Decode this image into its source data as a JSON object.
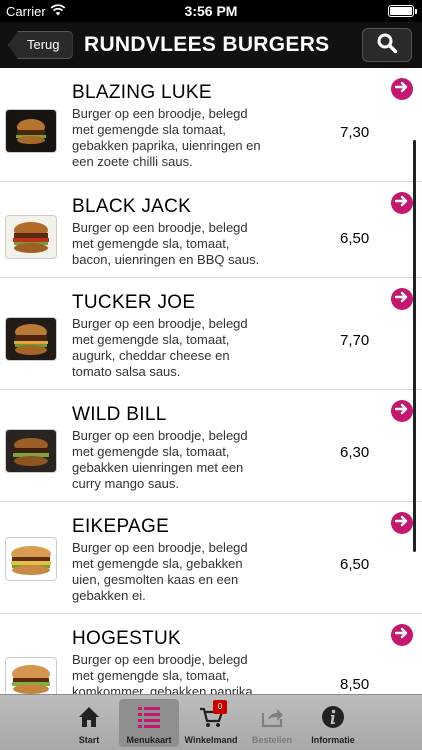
{
  "status_bar": {
    "carrier": "Carrier",
    "time": "3:56 PM",
    "battery_level": 1.0
  },
  "nav": {
    "back_label": "Terug",
    "title": "RUNDVLEES BURGERS",
    "search_icon": "search-icon"
  },
  "menu_items": [
    {
      "name": "BLAZING LUKE",
      "description": "Burger op een broodje, belegd met gemengde sla tomaat, gebakken paprika, uienringen en een zoete chilli saus.",
      "price": "7,30"
    },
    {
      "name": "BLACK JACK",
      "description": "Burger op een broodje, belegd met gemengde sla, tomaat, bacon, uienringen en BBQ saus.",
      "price": "6,50"
    },
    {
      "name": "TUCKER JOE",
      "description": "Burger op een broodje, belegd met gemengde sla, tomaat, augurk, cheddar cheese en tomato salsa saus.",
      "price": "7,70"
    },
    {
      "name": "WILD BILL",
      "description": "Burger op een broodje, belegd met gemengde sla, tomaat, gebakken uienringen met een curry mango saus.",
      "price": "6,30"
    },
    {
      "name": "EIKEPAGE",
      "description": "Burger op een broodje, belegd met gemengde sla, gebakken uien, gesmolten kaas en een gebakken ei.",
      "price": "6,50"
    },
    {
      "name": "HOGESTUK",
      "description": "Burger op een broodje, belegd met gemengde sla, tomaat, komkommer, gebakken paprika,",
      "price": "8,50"
    }
  ],
  "tabs": [
    {
      "label": "Start",
      "icon": "home-icon"
    },
    {
      "label": "Menukaart",
      "icon": "menu-list-icon",
      "active": true
    },
    {
      "label": "Winkelmand",
      "icon": "cart-icon",
      "badge": "0"
    },
    {
      "label": "Bestellen",
      "icon": "share-icon",
      "disabled": true
    },
    {
      "label": "Informatie",
      "icon": "info-icon"
    }
  ],
  "colors": {
    "accent": "#c2186f",
    "nav_background": "#111111",
    "badge": "#c80000"
  }
}
